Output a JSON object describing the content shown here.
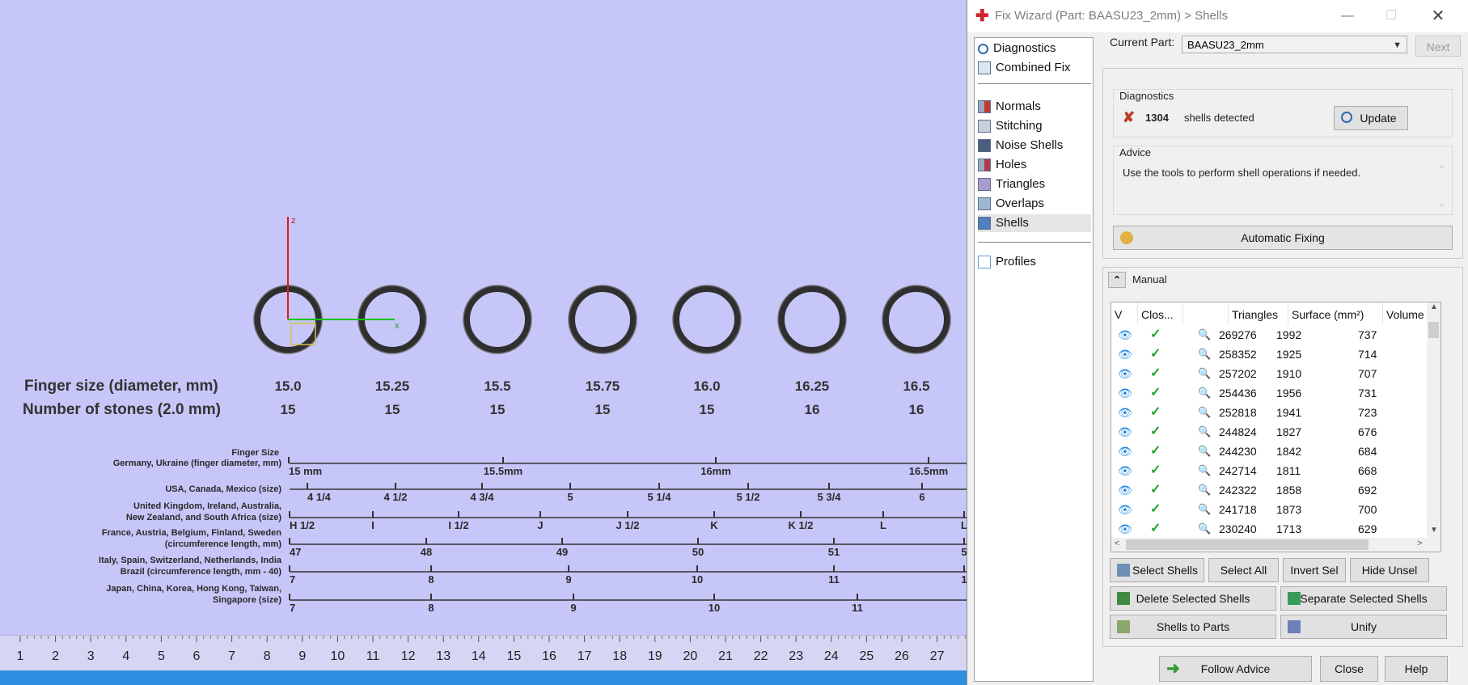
{
  "viewport": {
    "axes": {
      "z_label": "z",
      "x_label": "x"
    },
    "ring_chart": {
      "row1_label": "Finger size (diameter, mm)",
      "row1_values": [
        "15.0",
        "15.25",
        "15.5",
        "15.75",
        "16.0",
        "16.25",
        "16.5"
      ],
      "row2_label": "Number of stones (2.0 mm)",
      "row2_values": [
        "15",
        "15",
        "15",
        "15",
        "15",
        "16",
        "16"
      ]
    },
    "size_chart": {
      "header": "Finger Size",
      "rows": [
        {
          "label1": "Germany, Ukraine (finger diameter, mm)",
          "label2": "",
          "ticks": [
            "15 mm",
            "15.5mm",
            "16mm",
            "16.5mm"
          ]
        },
        {
          "label1": "USA, Canada, Mexico (size)",
          "label2": "",
          "ticks": [
            "4 1/4",
            "4 1/2",
            "4 3/4",
            "5",
            "5 1/4",
            "5 1/2",
            "5 3/4",
            "6"
          ]
        },
        {
          "label1": "United Kingdom, Ireland, Australia,",
          "label2": "New Zealand, and South Africa (size)",
          "ticks": [
            "H 1/2",
            "I",
            "I 1/2",
            "J",
            "J 1/2",
            "K",
            "K 1/2",
            "L",
            "L"
          ]
        },
        {
          "label1": "France, Austria, Belgium, Finland, Sweden",
          "label2": "(circumference length, mm)",
          "ticks": [
            "47",
            "48",
            "49",
            "50",
            "51",
            "5"
          ]
        },
        {
          "label1": "Italy, Spain, Switzerland, Netherlands, India",
          "label2": "Brazil (circumference length, mm - 40)",
          "ticks": [
            "7",
            "8",
            "9",
            "10",
            "11",
            "1"
          ]
        },
        {
          "label1": "Japan, China, Korea, Hong Kong, Taiwan,",
          "label2": "Singapore (size)",
          "ticks": [
            "7",
            "8",
            "9",
            "10",
            "11"
          ]
        }
      ]
    },
    "ruler": [
      "1",
      "2",
      "3",
      "4",
      "5",
      "6",
      "7",
      "8",
      "9",
      "10",
      "11",
      "12",
      "13",
      "14",
      "15",
      "16",
      "17",
      "18",
      "19",
      "20",
      "21",
      "22",
      "23",
      "24",
      "25",
      "26",
      "27"
    ]
  },
  "dialog": {
    "title": "Fix Wizard (Part: BAASU23_2mm) > Shells",
    "nav": [
      {
        "label": "Diagnostics",
        "icon": "magnifier-icon",
        "color": "#2b6cb0"
      },
      {
        "label": "Combined Fix",
        "icon": "combined-fix-icon",
        "color": "#8fb3d9"
      },
      {
        "label": "Normals",
        "icon": "normals-icon",
        "color": "#c0392b"
      },
      {
        "label": "Stitching",
        "icon": "stitching-icon",
        "color": "#8a9bb5"
      },
      {
        "label": "Noise Shells",
        "icon": "noise-shells-icon",
        "color": "#4a5d7e"
      },
      {
        "label": "Holes",
        "icon": "holes-icon",
        "color": "#b03a48"
      },
      {
        "label": "Triangles",
        "icon": "triangles-icon",
        "color": "#7a62a8"
      },
      {
        "label": "Overlaps",
        "icon": "overlaps-icon",
        "color": "#6f8fb8"
      },
      {
        "label": "Shells",
        "icon": "shells-icon",
        "color": "#4f7fc0"
      },
      {
        "label": "Profiles",
        "icon": "profiles-icon",
        "color": "#6a9ad0"
      }
    ],
    "current_part_label": "Current Part:",
    "current_part_value": "BAASU23_2mm",
    "next_label": "Next",
    "diagnostics": {
      "heading": "Diagnostics",
      "count": "1304",
      "text": "shells detected",
      "update_label": "Update"
    },
    "advice": {
      "heading": "Advice",
      "text": "Use the tools to perform shell operations if needed."
    },
    "automatic_fixing_label": "Automatic Fixing",
    "manual_label": "Manual",
    "table": {
      "columns": [
        "V",
        "Clos...",
        "",
        "Triangles",
        "Surface (mm²)",
        "Volume"
      ],
      "rows": [
        {
          "triangles": "269276",
          "surface": "1992",
          "volume": "737"
        },
        {
          "triangles": "258352",
          "surface": "1925",
          "volume": "714"
        },
        {
          "triangles": "257202",
          "surface": "1910",
          "volume": "707"
        },
        {
          "triangles": "254436",
          "surface": "1956",
          "volume": "731"
        },
        {
          "triangles": "252818",
          "surface": "1941",
          "volume": "723"
        },
        {
          "triangles": "244824",
          "surface": "1827",
          "volume": "676"
        },
        {
          "triangles": "244230",
          "surface": "1842",
          "volume": "684"
        },
        {
          "triangles": "242714",
          "surface": "1811",
          "volume": "668"
        },
        {
          "triangles": "242322",
          "surface": "1858",
          "volume": "692"
        },
        {
          "triangles": "241718",
          "surface": "1873",
          "volume": "700"
        },
        {
          "triangles": "230240",
          "surface": "1713",
          "volume": "629"
        }
      ]
    },
    "buttons": {
      "select_shells": "Select Shells",
      "select_all": "Select All",
      "invert_sel": "Invert Sel",
      "hide_unsel": "Hide Unsel",
      "delete_selected": "Delete Selected Shells",
      "separate_selected": "Separate Selected Shells",
      "shells_to_parts": "Shells to Parts",
      "unify": "Unify",
      "follow_advice": "Follow Advice",
      "close": "Close",
      "help": "Help"
    }
  }
}
